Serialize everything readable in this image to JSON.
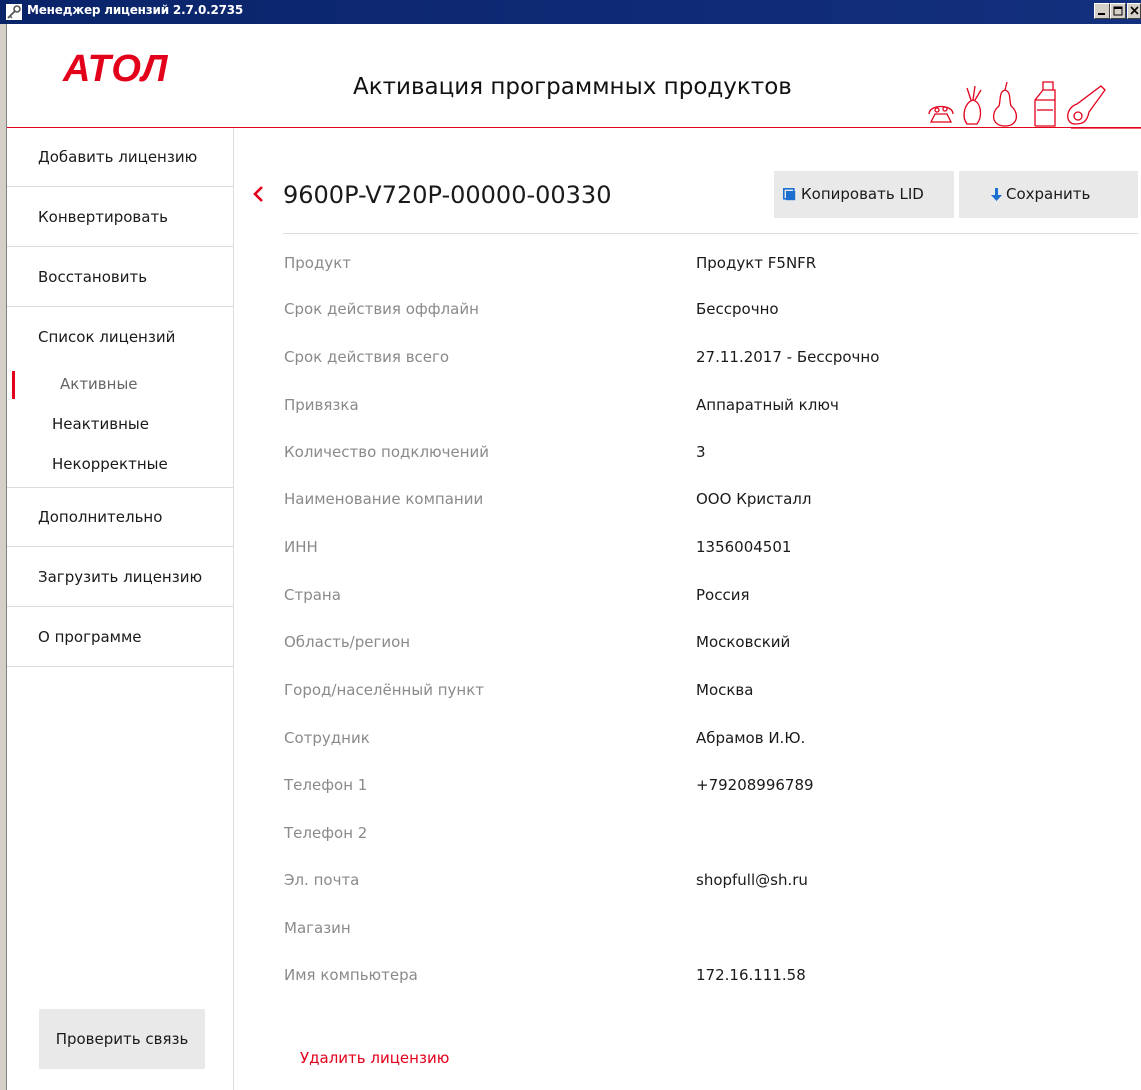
{
  "window": {
    "title": "Менеджер лицензий 2.7.0.2735",
    "icon": "key-icon"
  },
  "header": {
    "logo_text": "АТОЛ",
    "title": "Активация программных продуктов",
    "accent_color": "#e3001b"
  },
  "sidebar": {
    "items": [
      {
        "label": "Добавить лицензию"
      },
      {
        "label": "Конвертировать"
      },
      {
        "label": "Восстановить"
      },
      {
        "label": "Список лицензий"
      },
      {
        "label": "Дополнительно"
      },
      {
        "label": "Загрузить лицензию"
      },
      {
        "label": "О программе"
      }
    ],
    "sub_items": [
      {
        "label": "Активные",
        "active": true
      },
      {
        "label": "Неактивные",
        "active": false
      },
      {
        "label": "Некорректные",
        "active": false
      }
    ],
    "check_button": "Проверить связь"
  },
  "license": {
    "lid": "9600P-V720P-00000-00330",
    "copy_button": "Копировать LID",
    "save_button": "Сохранить",
    "fields": [
      {
        "label": "Продукт",
        "value": "Продукт F5NFR"
      },
      {
        "label": "Срок действия оффлайн",
        "value": "Бессрочно"
      },
      {
        "label": "Срок действия всего",
        "value": "27.11.2017 - Бессрочно"
      },
      {
        "label": "Привязка",
        "value": "Аппаратный ключ"
      },
      {
        "label": "Количество подключений",
        "value": "3"
      },
      {
        "label": "Наименование компании",
        "value": "ООО Кристалл"
      },
      {
        "label": "ИНН",
        "value": "1356004501"
      },
      {
        "label": "Страна",
        "value": "Россия"
      },
      {
        "label": "Область/регион",
        "value": "Московский"
      },
      {
        "label": "Город/населённый пункт",
        "value": "Москва"
      },
      {
        "label": "Сотрудник",
        "value": "Абрамов И.Ю."
      },
      {
        "label": "Телефон 1",
        "value": "+79208996789"
      },
      {
        "label": "Телефон 2",
        "value": ""
      },
      {
        "label": "Эл. почта",
        "value": "shopfull@sh.ru"
      },
      {
        "label": "Магазин",
        "value": ""
      },
      {
        "label": "Имя компьютера",
        "value": "172.16.111.58"
      }
    ],
    "delete_link": "Удалить лицензию"
  }
}
